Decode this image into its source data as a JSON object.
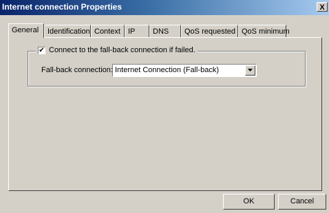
{
  "window": {
    "title": "Internet connection Properties",
    "close_label": "X"
  },
  "tabs": [
    {
      "label": "General",
      "active": true
    },
    {
      "label": "Identification",
      "active": false
    },
    {
      "label": "Context",
      "active": false
    },
    {
      "label": "IP",
      "active": false
    },
    {
      "label": "DNS",
      "active": false
    },
    {
      "label": "QoS requested",
      "active": false
    },
    {
      "label": "QoS minimum",
      "active": false
    }
  ],
  "general": {
    "fallback_checkbox_label": "Connect to the fall-back connection if failed.",
    "fallback_checked": true,
    "checkbox_mark": "✔",
    "fallback_connection_label": "Fall-back connection:",
    "fallback_connection_value": "Internet Connection (Fall-back)"
  },
  "buttons": {
    "ok": "OK",
    "cancel": "Cancel"
  },
  "colors": {
    "face": "#d4d0c8",
    "title_start": "#0a246a",
    "title_end": "#a6caf0"
  },
  "icons": {
    "close": "close-icon",
    "dropdown": "dropdown-arrow-icon"
  }
}
